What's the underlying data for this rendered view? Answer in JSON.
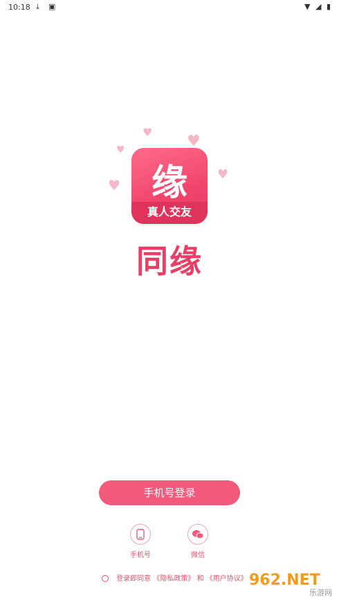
{
  "status_bar": {
    "time": "10:18",
    "left_icons": [
      "download-icon",
      "a-letter-icon"
    ],
    "right_icons": [
      "wifi-icon",
      "signal-icon",
      "battery-icon"
    ]
  },
  "logo": {
    "icon_glyph": "缘",
    "icon_tagline": "真人交友",
    "app_name": "同缘"
  },
  "actions": {
    "primary_login_label": "手机号登录",
    "alt_methods": [
      {
        "label": "手机号",
        "icon": "phone-icon"
      },
      {
        "label": "微信",
        "icon": "wechat-icon"
      }
    ]
  },
  "agreement": {
    "prefix": "登录即同意",
    "privacy_link": "《隐私政策》",
    "conjunction": "和",
    "terms_link": "《用户协议》"
  },
  "watermark": {
    "main": "962.NET",
    "sub": "乐游网"
  },
  "colors": {
    "brand_pink": "#f15a7b",
    "brand_red": "#e83f66",
    "heart_pink": "#f7b6c6"
  }
}
